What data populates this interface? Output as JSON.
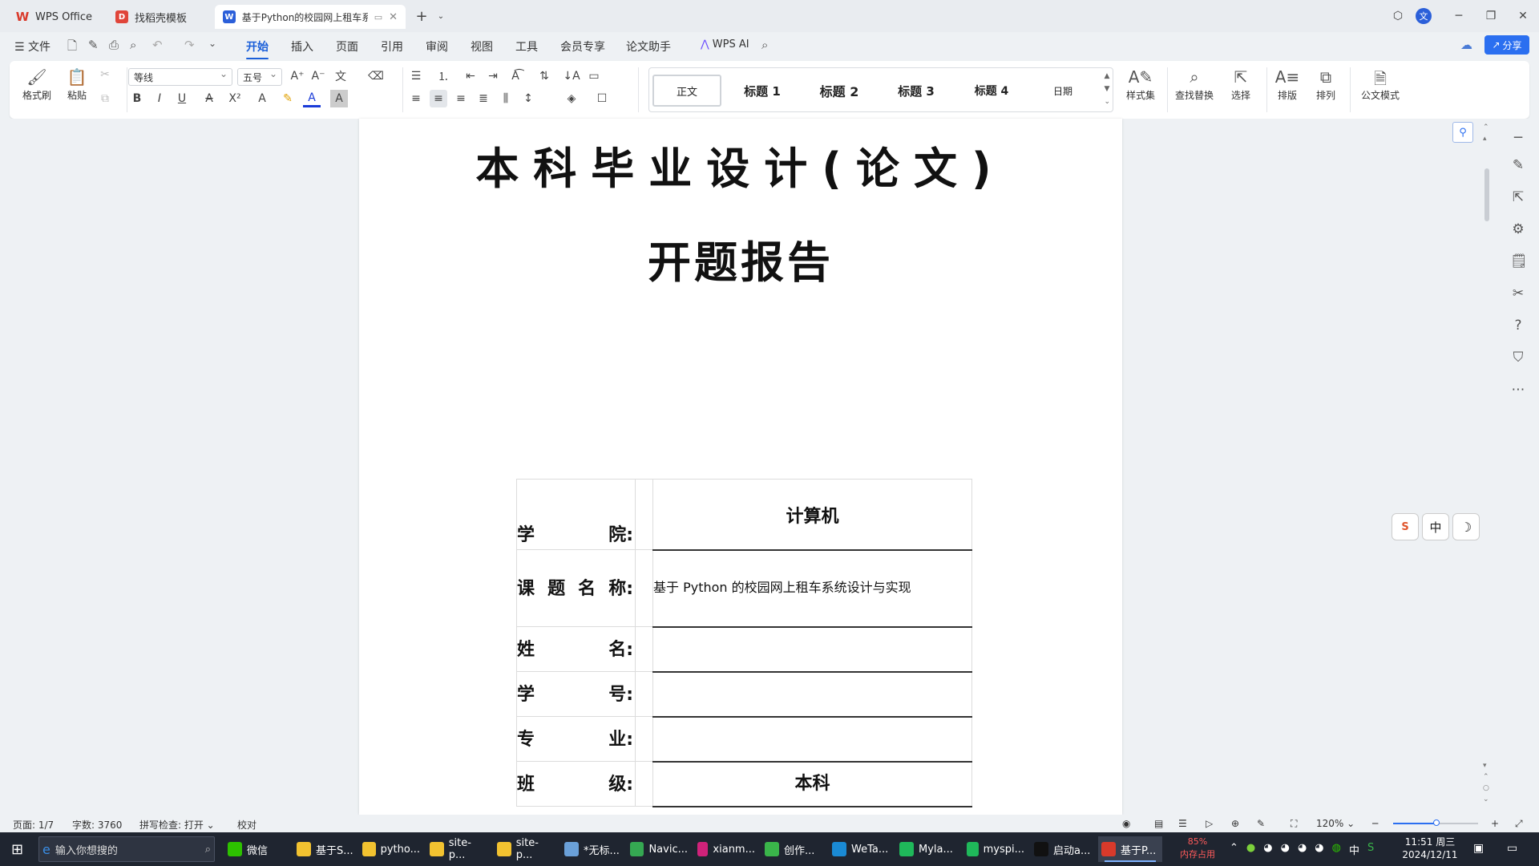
{
  "titlebar": {
    "tabs": [
      {
        "label": "WPS Office",
        "icon": "wps-logo-icon"
      },
      {
        "label": "找稻壳模板",
        "icon": "docer-icon"
      },
      {
        "label": "基于Python的校园网上租车系",
        "icon": "word-doc-icon"
      }
    ],
    "new_tab": "+"
  },
  "menubar": {
    "file_label": "文件",
    "items": [
      "开始",
      "插入",
      "页面",
      "引用",
      "审阅",
      "视图",
      "工具",
      "会员专享",
      "论文助手"
    ],
    "active": "开始",
    "ai_label": "WPS AI",
    "share_label": "分享"
  },
  "ribbon": {
    "format_painter": "格式刷",
    "paste": "粘贴",
    "font_name": "等线",
    "font_size": "五号",
    "styles": [
      "正文",
      "标题 1",
      "标题 2",
      "标题 3",
      "标题 4",
      "日期"
    ],
    "style_set": "样式集",
    "find_replace": "查找替换",
    "select": "选择",
    "layout": "排版",
    "arrange": "排列",
    "doc_mode": "公文模式"
  },
  "document": {
    "title": "本科毕业设计(论文)",
    "subtitle": "开题报告",
    "rows": [
      {
        "label": "学院:",
        "value": "计算机"
      },
      {
        "label": "课题名称:",
        "value": "基于 Python 的校园网上租车系统设计与实现"
      },
      {
        "label": "姓名:",
        "value": ""
      },
      {
        "label": "学号:",
        "value": ""
      },
      {
        "label": "专业:",
        "value": ""
      },
      {
        "label": "班级:",
        "value": "本科"
      }
    ]
  },
  "float_tools": [
    "S",
    "中",
    "☽"
  ],
  "status": {
    "page": "页面: 1/7",
    "words": "字数: 3760",
    "spell": "拼写检查: 打开",
    "proof": "校对",
    "zoom": "120%"
  },
  "taskbar": {
    "search_placeholder": "输入你想搜的",
    "apps": [
      {
        "label": "微信",
        "color": "#2dc100"
      },
      {
        "label": "基于S...",
        "color": "#f2c230"
      },
      {
        "label": "pytho...",
        "color": "#f2c230"
      },
      {
        "label": "site-p...",
        "color": "#f2c230"
      },
      {
        "label": "site-p...",
        "color": "#f2c230"
      },
      {
        "label": "*无标...",
        "color": "#6aa0d8"
      },
      {
        "label": "Navic...",
        "color": "#35a852"
      },
      {
        "label": "xianm...",
        "color": "#d0227a"
      },
      {
        "label": "创作...",
        "color": "#3ab54a"
      },
      {
        "label": "WeTa...",
        "color": "#1a8ad4"
      },
      {
        "label": "Myla...",
        "color": "#1fb85a"
      },
      {
        "label": "myspi...",
        "color": "#1fb85a"
      },
      {
        "label": "启动a...",
        "color": "#111111"
      },
      {
        "label": "基于P...",
        "color": "#d93a2b"
      }
    ],
    "mem": "85%",
    "mem_label": "内存占用",
    "ime": "中",
    "time": "11:51 周三",
    "date": "2024/12/11"
  }
}
